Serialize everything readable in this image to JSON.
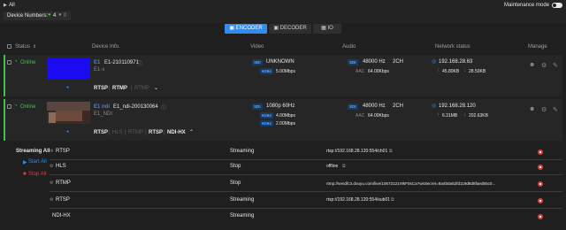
{
  "top": {
    "group": "All",
    "device_numbers_label": "Device Numbers:",
    "online_count": "4",
    "offline_count": "0",
    "maintenance_label": "Maintenance mode"
  },
  "tabs": [
    {
      "label": "ENCODER",
      "active": true
    },
    {
      "label": "DECODER",
      "active": false
    },
    {
      "label": "IO",
      "active": false
    }
  ],
  "columns": {
    "status": "Status",
    "device_info": "Device Info.",
    "video": "Video",
    "audio": "Audio",
    "network": "Network status",
    "manage": "Manage"
  },
  "devices": [
    {
      "status": "Online",
      "index": "E1",
      "name": "E1-210110971",
      "sub": "E1-x",
      "video_badge_1": "SDI",
      "video_1": "UNKNOWN",
      "video_badge_2": "H264",
      "video_2": "5.00Mbps",
      "audio_badge_1": "SDI",
      "audio_1a": "48000 Hz",
      "audio_1b": "2CH",
      "audio_codec": "AAC",
      "audio_2": "64.00Kbps",
      "ip": "192.168.28.63",
      "up": "45.80KB",
      "down": "28.50KB",
      "protocols": [
        "RTSP",
        "RTMP",
        "RTMP"
      ]
    },
    {
      "status": "Online",
      "index": "E1 ndi",
      "name": "E1_ndi-200130064",
      "sub": "E1_NDI",
      "video_badge_1": "SDI",
      "video_1": "1080p 60Hz",
      "video_badge_2": "H264",
      "video_2": "4.00Mbps",
      "video_badge_3": "H264",
      "video_3": "2.00Mbps",
      "audio_badge_1": "SDI",
      "audio_1a": "48000 Hz",
      "audio_1b": "2CH",
      "audio_codec": "AAC",
      "audio_2": "64.00Kbps",
      "ip": "192.168.28.120",
      "up": "6.31MB",
      "down": "202.63KB",
      "protocols": [
        "RTSP",
        "HLS",
        "RTMP",
        "RTSP",
        "NDI-HX"
      ]
    }
  ],
  "streaming": {
    "title": "Streaming All",
    "start_all": "Start All",
    "stop_all": "Stop All",
    "rows": [
      {
        "protocol": "RTSP",
        "state": "Streaming",
        "url": "rtsp://192.168.28.120:554/ch01"
      },
      {
        "protocol": "HLS",
        "state": "Stop",
        "url": "offline"
      },
      {
        "protocol": "RTMP",
        "state": "Stop",
        "url": "rtmp://sendfc3.douyu.com/live/10673121r9kF0sCa?wsSecret=8a4b0a52fd119d8d8faed55c0..."
      },
      {
        "protocol": "RTSP",
        "state": "Streaming",
        "url": "rtsp://192.168.28.120:554/sub01"
      },
      {
        "protocol": "NDI-HX",
        "state": "Streaming",
        "url": ""
      }
    ]
  },
  "colors": {
    "accent": "#2f8cf0",
    "online": "#3ec44a",
    "stop": "#e23c3c"
  }
}
